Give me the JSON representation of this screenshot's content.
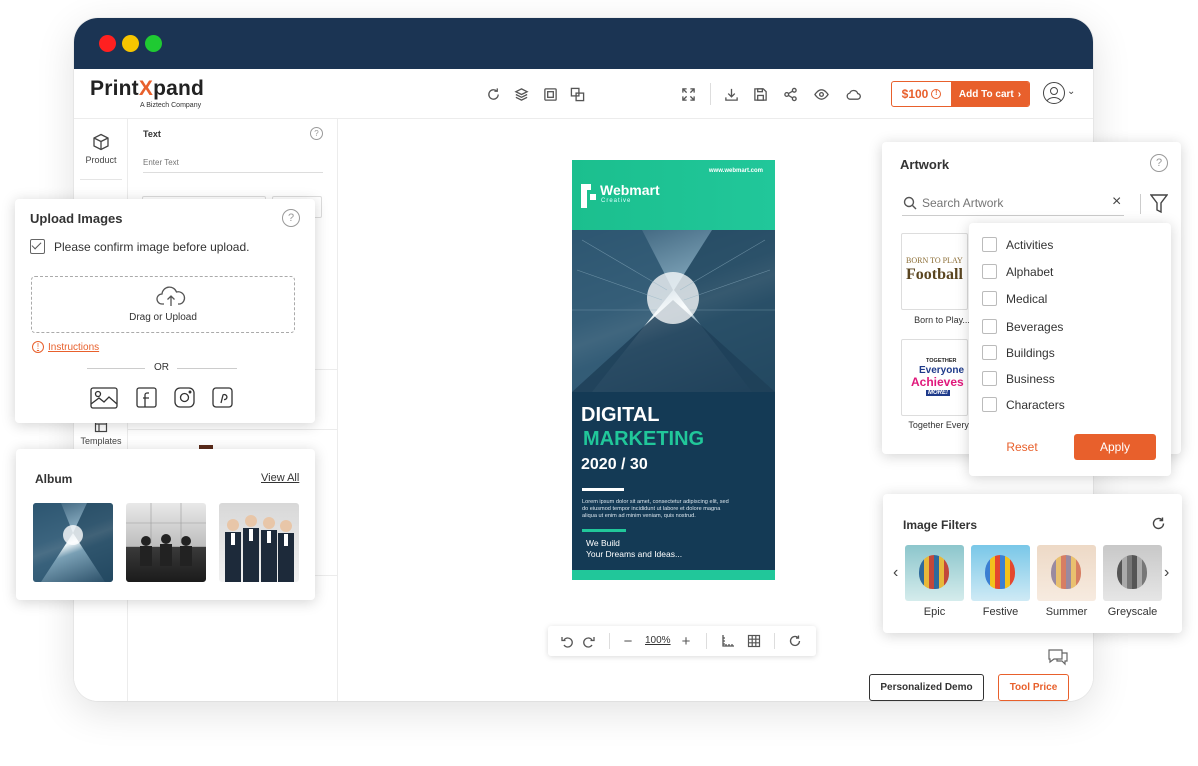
{
  "app": {
    "logo_prefix": "Print",
    "logo_x": "X",
    "logo_suffix": "pand",
    "logo_tagline": "A Biztech Company"
  },
  "colors": {
    "accent": "#e8602c",
    "titlebar": "#1b3453",
    "traffic_red": "#ff2020",
    "traffic_yellow": "#f6c500",
    "traffic_green": "#1fca32",
    "poster_teal": "#21c79a",
    "poster_navy": "#143a55"
  },
  "toolbar": {
    "icons": [
      "refresh-icon",
      "layers-icon",
      "duplicate-icon",
      "group-icon",
      "fullscreen-icon",
      "download-icon",
      "save-icon",
      "share-icon",
      "preview-icon",
      "cloud-icon"
    ],
    "price": "$100",
    "add_to_cart": "Add To cart"
  },
  "sidebar": {
    "items": [
      {
        "label": "Product",
        "icon": "cube-icon"
      },
      {
        "label": "Templates",
        "icon": "templates-icon"
      }
    ]
  },
  "text_panel": {
    "title": "Text",
    "placeholder": "Enter Text"
  },
  "upload_images": {
    "title": "Upload Images",
    "confirm_label": "Please confirm image before upload.",
    "drop_label": "Drag or Upload",
    "instructions": "Instructions",
    "or": "OR",
    "sources": [
      "gallery-icon",
      "facebook-icon",
      "instagram-icon",
      "pinterest-icon"
    ]
  },
  "album": {
    "title": "Album",
    "view_all": "View All"
  },
  "poster": {
    "site": "www.webmart.com",
    "brand": "Webmart",
    "brand_sub": "Creative",
    "line1": "DIGITAL",
    "line2": "MARKETING",
    "line3": "2020 / 30",
    "lorem": "Lorem ipsum dolor sit amet, consectetur adipiscing elit, sed do eiusmod tempor incididunt ut labore et dolore magna aliqua ut enim ad minim veniam, quis nostrud.",
    "tag1": "We Build",
    "tag2": "Your Dreams and Ideas..."
  },
  "zoom": {
    "value": "100%"
  },
  "artwork": {
    "title": "Artwork",
    "search_placeholder": "Search Artwork",
    "items": [
      {
        "label": "Born to Play...",
        "art_line1": "BORN TO PLAY",
        "art_line2": "Football"
      },
      {
        "label": "Together Every...",
        "art_line1": "TOGETHER",
        "art_line2": "Everyone",
        "art_line3": "Achieves",
        "art_line4": "MORE!"
      }
    ],
    "categories": [
      "Activities",
      "Alphabet",
      "Medical",
      "Beverages",
      "Buildings",
      "Business",
      "Characters"
    ],
    "reset": "Reset",
    "apply": "Apply"
  },
  "image_filters": {
    "title": "Image Filters",
    "filters": [
      "Epic",
      "Festive",
      "Summer",
      "Greyscale"
    ]
  },
  "buttons": {
    "personalized_demo": "Personalized Demo",
    "tool_price": "Tool Price"
  }
}
